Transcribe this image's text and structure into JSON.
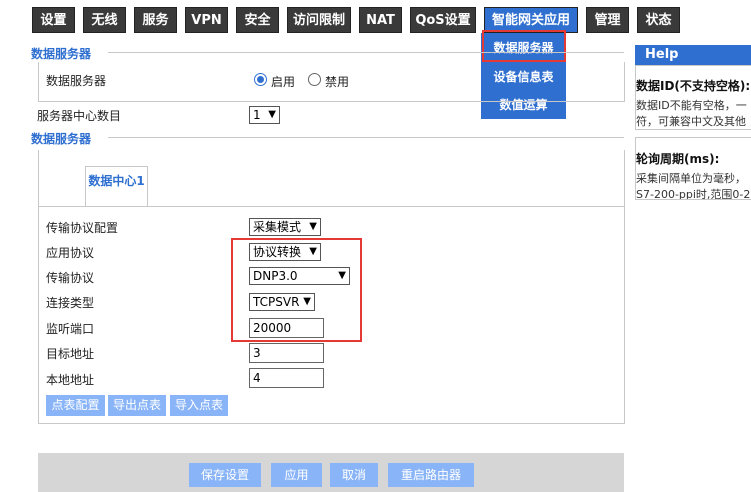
{
  "nav": {
    "tabs": [
      {
        "label": "设置"
      },
      {
        "label": "无线"
      },
      {
        "label": "服务"
      },
      {
        "label": "VPN"
      },
      {
        "label": "安全"
      },
      {
        "label": "访问限制"
      },
      {
        "label": "NAT"
      },
      {
        "label": "QoS设置"
      },
      {
        "label": "智能网关应用",
        "active": true
      },
      {
        "label": "管理"
      },
      {
        "label": "状态"
      }
    ],
    "dropdown": [
      {
        "label": "数据服务器",
        "highlighted": true
      },
      {
        "label": "设备信息表"
      },
      {
        "label": "数值运算"
      }
    ]
  },
  "main": {
    "section1_title": "数据服务器",
    "server_label": "数据服务器",
    "enable_label": "启用",
    "disable_label": "禁用",
    "enabled": true,
    "center_count_label": "服务器中心数目",
    "center_count_value": "1",
    "section2_title": "数据服务器",
    "subtab_label": "数据中心1",
    "fields": {
      "transport_config": {
        "label": "传输协议配置",
        "value": "采集模式"
      },
      "app_protocol": {
        "label": "应用协议",
        "value": "协议转换"
      },
      "transport_protocol": {
        "label": "传输协议",
        "value": "DNP3.0"
      },
      "connection_type": {
        "label": "连接类型",
        "value": "TCPSVR"
      },
      "listen_port": {
        "label": "监听端口",
        "value": "20000"
      },
      "target_address": {
        "label": "目标地址",
        "value": "3"
      },
      "local_address": {
        "label": "本地地址",
        "value": "4"
      }
    },
    "buttons": {
      "point_config": "点表配置",
      "export_points": "导出点表",
      "import_points": "导入点表"
    }
  },
  "footer": {
    "save": "保存设置",
    "apply": "应用",
    "cancel": "取消",
    "reboot": "重启路由器"
  },
  "help": {
    "title": "Help",
    "items": [
      {
        "title": "数据ID(不支持空格):",
        "lines": [
          "数据ID不能有空格，一",
          "符，可兼容中文及其他"
        ]
      },
      {
        "title": "轮询周期(ms):",
        "lines": [
          "采集间隔单位为毫秒，",
          "S7-200-ppi时,范围0-2"
        ]
      }
    ]
  },
  "colors": {
    "accent": "#2f6fd0",
    "tab_bg": "#3a3a3a",
    "highlight": "#e53935",
    "button": "#8ab4f8"
  }
}
